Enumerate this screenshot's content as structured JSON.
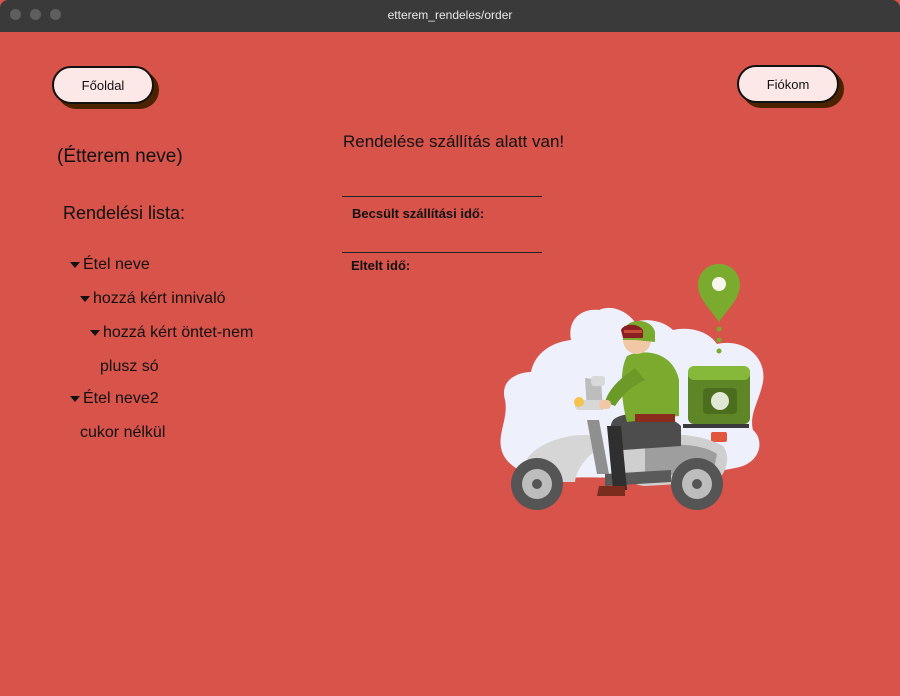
{
  "window": {
    "title": "etterem_rendeles/order"
  },
  "nav": {
    "home_label": "Főoldal",
    "account_label": "Fiókom"
  },
  "restaurant": {
    "name": "(Étterem neve)"
  },
  "order_list": {
    "title": "Rendelési lista:",
    "items": [
      {
        "label": "Étel neve"
      },
      {
        "label": "hozzá kért innivaló"
      },
      {
        "label": "hozzá kért öntet-nem"
      },
      {
        "label": "plusz só"
      },
      {
        "label": "Étel neve2"
      },
      {
        "label": "cukor nélkül"
      }
    ]
  },
  "delivery": {
    "status": "Rendelése szállítás alatt van!",
    "estimated_label": "Becsült szállítási idő:",
    "elapsed_label": "Eltelt idő:"
  },
  "colors": {
    "background": "#d8534a",
    "button": "#fde8e8",
    "button_shadow": "#4b2200",
    "rider_green": "#7aab2f"
  }
}
